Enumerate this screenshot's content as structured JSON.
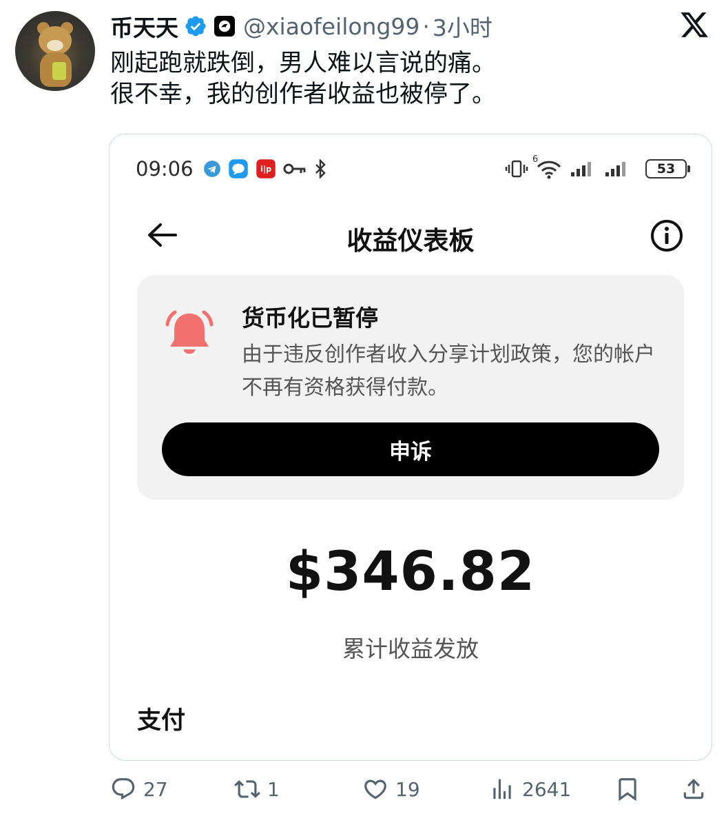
{
  "tweet": {
    "display_name": "币天天",
    "handle": "@xiaofeilong99",
    "separator": "·",
    "time_ago": "3小时",
    "text_lines": [
      "刚起跑就跌倒，男人难以言说的痛。",
      "很不幸，我的创作者收益也被停了。"
    ]
  },
  "screenshot": {
    "status_bar": {
      "time": "09:06",
      "battery": "53",
      "network_badge": "6"
    },
    "app_title": "收益仪表板",
    "notice": {
      "title": "货币化已暂停",
      "body": "由于违反创作者收入分享计划政策，您的帐户不再有资格获得付款。",
      "button_label": "申诉"
    },
    "amount": "$346.82",
    "amount_label": "累计收益发放",
    "section_title": "支付"
  },
  "actions": {
    "replies": "27",
    "reposts": "1",
    "likes": "19",
    "views": "2641"
  },
  "colors": {
    "verified_blue": "#1d9bf0",
    "bell_red": "#f2706e",
    "muted_text": "#536471"
  },
  "icons": [
    "verified-icon",
    "affiliate-badge-icon",
    "x-logo-icon",
    "telegram-icon",
    "message-icon",
    "app-icon",
    "key-icon",
    "bluetooth-icon",
    "vibrate-icon",
    "wifi-icon",
    "signal-icon",
    "battery-icon",
    "back-arrow-icon",
    "info-icon",
    "bell-icon",
    "reply-icon",
    "repost-icon",
    "like-icon",
    "views-icon",
    "bookmark-icon",
    "share-icon"
  ]
}
